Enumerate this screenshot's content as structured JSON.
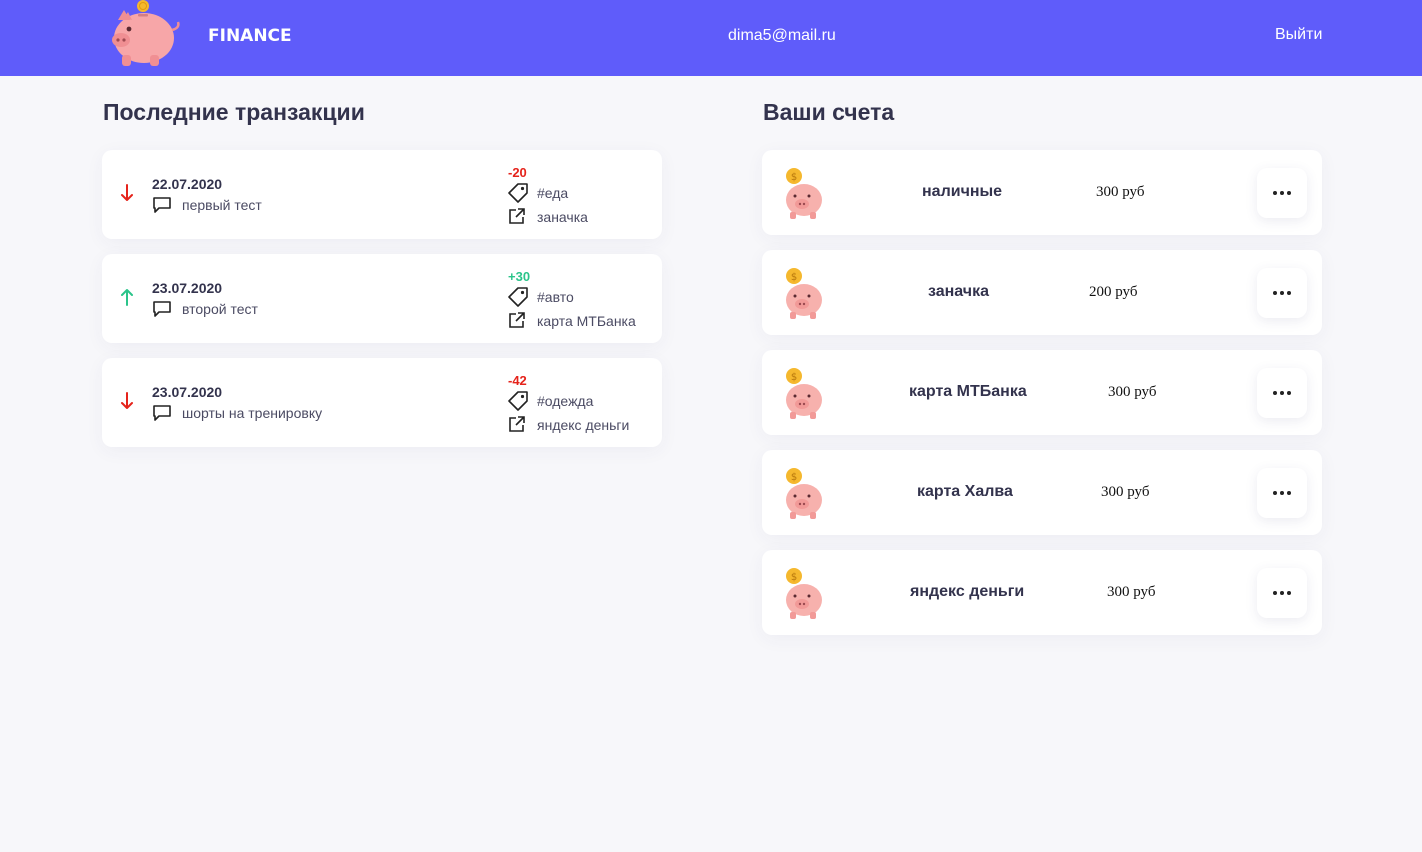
{
  "header": {
    "brand": "FINANCE",
    "user_email": "dima5@mail.ru",
    "logout_label": "Выйти",
    "background_color": "#5f5cfa"
  },
  "transactions": {
    "title": "Последние транзакции",
    "items": [
      {
        "direction": "down",
        "date": "22.07.2020",
        "comment": "первый тест",
        "amount": "-20",
        "tag": "#еда",
        "account": "заначка"
      },
      {
        "direction": "up",
        "date": "23.07.2020",
        "comment": "второй тест",
        "amount": "+30",
        "tag": "#авто",
        "account": "карта МТБанка"
      },
      {
        "direction": "down",
        "date": "23.07.2020",
        "comment": "шорты на тренировку",
        "amount": "-42",
        "tag": "#одежда",
        "account": "яндекс деньги"
      }
    ]
  },
  "accounts": {
    "title": "Ваши счета",
    "items": [
      {
        "name": "наличные",
        "balance": "300 руб"
      },
      {
        "name": "заначка",
        "balance": "200 руб"
      },
      {
        "name": "карта МТБанка",
        "balance": "300 руб"
      },
      {
        "name": "карта Халва",
        "balance": "300 руб"
      },
      {
        "name": "яндекс деньги",
        "balance": "300 руб"
      }
    ]
  },
  "colors": {
    "expense": "#e5231b",
    "income": "#2bc48a",
    "accent": "#5f5cfa"
  },
  "icons": {
    "logo": "piggy-bank-icon",
    "arrow_down": "arrow-down-icon",
    "arrow_up": "arrow-up-icon",
    "comment": "comment-icon",
    "tag": "tag-icon",
    "account": "external-link-icon",
    "menu": "more-dots-icon"
  }
}
